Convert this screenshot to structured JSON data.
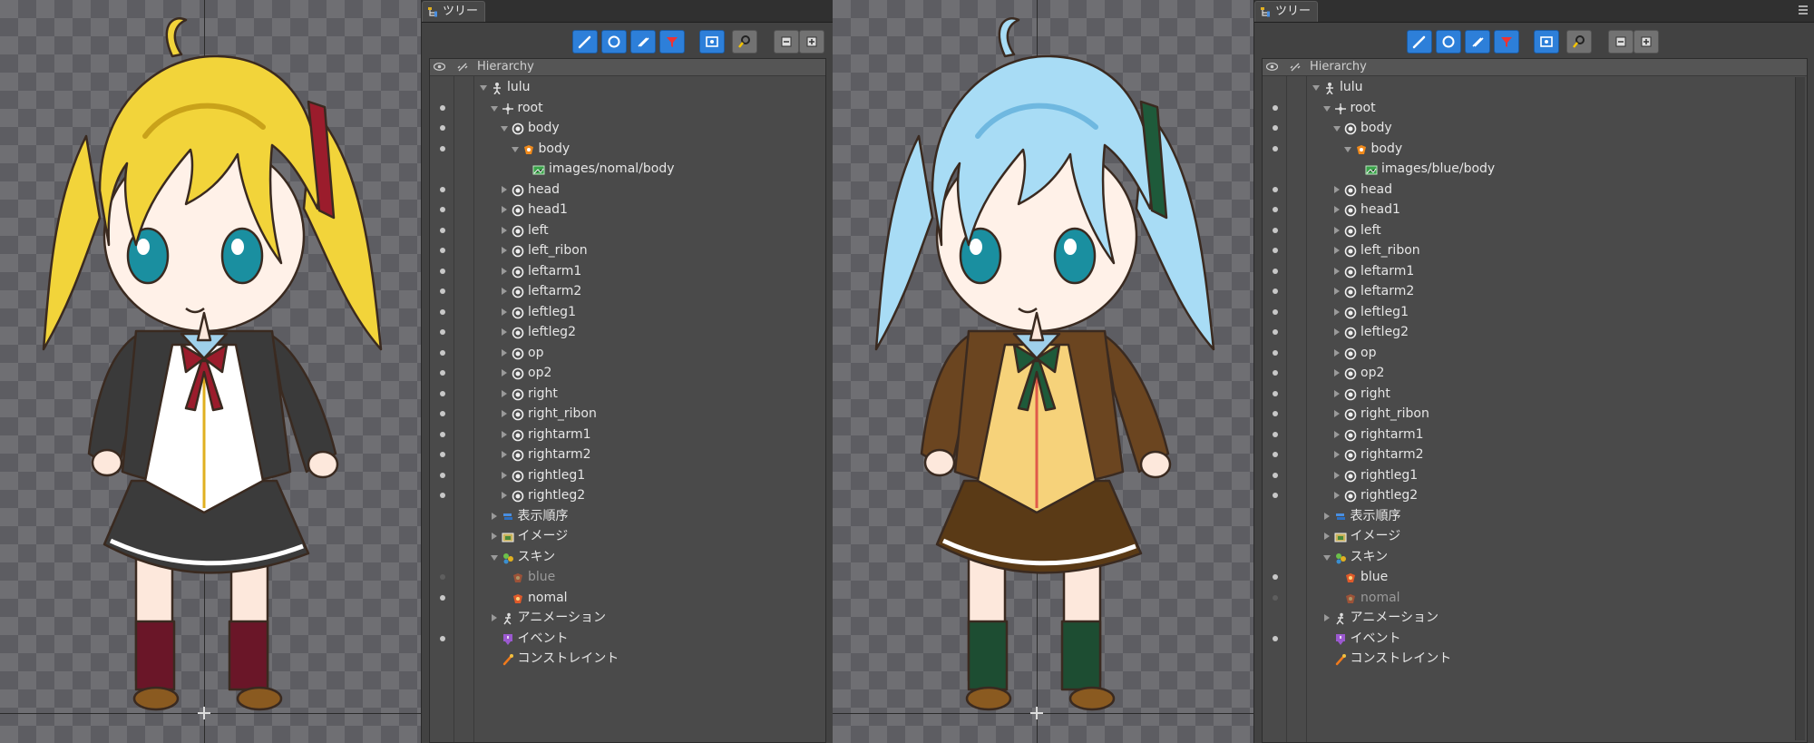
{
  "panels": [
    {
      "tab_label": "ツリー",
      "header_label": "Hierarchy",
      "rows": [
        {
          "label": "lulu",
          "depth": 0,
          "icon": "skeleton-icon",
          "expand": "down",
          "dot": "none"
        },
        {
          "label": "root",
          "depth": 1,
          "icon": "root-bone-icon",
          "expand": "down",
          "dot": "on"
        },
        {
          "label": "body",
          "depth": 2,
          "icon": "slot-icon",
          "expand": "down",
          "dot": "on"
        },
        {
          "label": "body",
          "depth": 3,
          "icon": "skin-attachment-icon",
          "expand": "down",
          "dot": "on"
        },
        {
          "label": "images/nomal/body",
          "depth": 4,
          "icon": "image-icon",
          "expand": "none",
          "dot": "none"
        },
        {
          "label": "head",
          "depth": 2,
          "icon": "slot-icon",
          "expand": "right",
          "dot": "on"
        },
        {
          "label": "head1",
          "depth": 2,
          "icon": "slot-icon",
          "expand": "right",
          "dot": "on"
        },
        {
          "label": "left",
          "depth": 2,
          "icon": "slot-icon",
          "expand": "right",
          "dot": "on"
        },
        {
          "label": "left_ribon",
          "depth": 2,
          "icon": "slot-icon",
          "expand": "right",
          "dot": "on"
        },
        {
          "label": "leftarm1",
          "depth": 2,
          "icon": "slot-icon",
          "expand": "right",
          "dot": "on"
        },
        {
          "label": "leftarm2",
          "depth": 2,
          "icon": "slot-icon",
          "expand": "right",
          "dot": "on"
        },
        {
          "label": "leftleg1",
          "depth": 2,
          "icon": "slot-icon",
          "expand": "right",
          "dot": "on"
        },
        {
          "label": "leftleg2",
          "depth": 2,
          "icon": "slot-icon",
          "expand": "right",
          "dot": "on"
        },
        {
          "label": "op",
          "depth": 2,
          "icon": "slot-icon",
          "expand": "right",
          "dot": "on"
        },
        {
          "label": "op2",
          "depth": 2,
          "icon": "slot-icon",
          "expand": "right",
          "dot": "on"
        },
        {
          "label": "right",
          "depth": 2,
          "icon": "slot-icon",
          "expand": "right",
          "dot": "on"
        },
        {
          "label": "right_ribon",
          "depth": 2,
          "icon": "slot-icon",
          "expand": "right",
          "dot": "on"
        },
        {
          "label": "rightarm1",
          "depth": 2,
          "icon": "slot-icon",
          "expand": "right",
          "dot": "on"
        },
        {
          "label": "rightarm2",
          "depth": 2,
          "icon": "slot-icon",
          "expand": "right",
          "dot": "on"
        },
        {
          "label": "rightleg1",
          "depth": 2,
          "icon": "slot-icon",
          "expand": "right",
          "dot": "on"
        },
        {
          "label": "rightleg2",
          "depth": 2,
          "icon": "slot-icon",
          "expand": "right",
          "dot": "on"
        },
        {
          "label": "表示順序",
          "depth": 1,
          "icon": "draw-order-icon",
          "expand": "right",
          "dot": "none"
        },
        {
          "label": "イメージ",
          "depth": 1,
          "icon": "images-folder-icon",
          "expand": "right",
          "dot": "none"
        },
        {
          "label": "スキン",
          "depth": 1,
          "icon": "skins-icon",
          "expand": "down",
          "dot": "none"
        },
        {
          "label": "blue",
          "depth": 2,
          "icon": "skin-icon",
          "expand": "none",
          "dot": "dim",
          "dim": true
        },
        {
          "label": "nomal",
          "depth": 2,
          "icon": "skin-icon",
          "expand": "none",
          "dot": "on"
        },
        {
          "label": "アニメーション",
          "depth": 1,
          "icon": "animation-icon",
          "expand": "right",
          "dot": "none"
        },
        {
          "label": "イベント",
          "depth": 1,
          "icon": "event-icon",
          "expand": "none",
          "dot": "on"
        },
        {
          "label": "コンストレイント",
          "depth": 1,
          "icon": "constraint-icon",
          "expand": "none",
          "dot": "none"
        }
      ]
    },
    {
      "tab_label": "ツリー",
      "header_label": "Hierarchy",
      "rows": [
        {
          "label": "lulu",
          "depth": 0,
          "icon": "skeleton-icon",
          "expand": "down",
          "dot": "none"
        },
        {
          "label": "root",
          "depth": 1,
          "icon": "root-bone-icon",
          "expand": "down",
          "dot": "on"
        },
        {
          "label": "body",
          "depth": 2,
          "icon": "slot-icon",
          "expand": "down",
          "dot": "on"
        },
        {
          "label": "body",
          "depth": 3,
          "icon": "skin-attachment-icon",
          "expand": "down",
          "dot": "on"
        },
        {
          "label": "images/blue/body",
          "depth": 4,
          "icon": "image-icon",
          "expand": "none",
          "dot": "none"
        },
        {
          "label": "head",
          "depth": 2,
          "icon": "slot-icon",
          "expand": "right",
          "dot": "on"
        },
        {
          "label": "head1",
          "depth": 2,
          "icon": "slot-icon",
          "expand": "right",
          "dot": "on"
        },
        {
          "label": "left",
          "depth": 2,
          "icon": "slot-icon",
          "expand": "right",
          "dot": "on"
        },
        {
          "label": "left_ribon",
          "depth": 2,
          "icon": "slot-icon",
          "expand": "right",
          "dot": "on"
        },
        {
          "label": "leftarm1",
          "depth": 2,
          "icon": "slot-icon",
          "expand": "right",
          "dot": "on"
        },
        {
          "label": "leftarm2",
          "depth": 2,
          "icon": "slot-icon",
          "expand": "right",
          "dot": "on"
        },
        {
          "label": "leftleg1",
          "depth": 2,
          "icon": "slot-icon",
          "expand": "right",
          "dot": "on"
        },
        {
          "label": "leftleg2",
          "depth": 2,
          "icon": "slot-icon",
          "expand": "right",
          "dot": "on"
        },
        {
          "label": "op",
          "depth": 2,
          "icon": "slot-icon",
          "expand": "right",
          "dot": "on"
        },
        {
          "label": "op2",
          "depth": 2,
          "icon": "slot-icon",
          "expand": "right",
          "dot": "on"
        },
        {
          "label": "right",
          "depth": 2,
          "icon": "slot-icon",
          "expand": "right",
          "dot": "on"
        },
        {
          "label": "right_ribon",
          "depth": 2,
          "icon": "slot-icon",
          "expand": "right",
          "dot": "on"
        },
        {
          "label": "rightarm1",
          "depth": 2,
          "icon": "slot-icon",
          "expand": "right",
          "dot": "on"
        },
        {
          "label": "rightarm2",
          "depth": 2,
          "icon": "slot-icon",
          "expand": "right",
          "dot": "on"
        },
        {
          "label": "rightleg1",
          "depth": 2,
          "icon": "slot-icon",
          "expand": "right",
          "dot": "on"
        },
        {
          "label": "rightleg2",
          "depth": 2,
          "icon": "slot-icon",
          "expand": "right",
          "dot": "on"
        },
        {
          "label": "表示順序",
          "depth": 1,
          "icon": "draw-order-icon",
          "expand": "right",
          "dot": "none"
        },
        {
          "label": "イメージ",
          "depth": 1,
          "icon": "images-folder-icon",
          "expand": "right",
          "dot": "none"
        },
        {
          "label": "スキン",
          "depth": 1,
          "icon": "skins-icon",
          "expand": "down",
          "dot": "none"
        },
        {
          "label": "blue",
          "depth": 2,
          "icon": "skin-icon",
          "expand": "none",
          "dot": "on"
        },
        {
          "label": "nomal",
          "depth": 2,
          "icon": "skin-icon",
          "expand": "none",
          "dot": "dim",
          "dim": true
        },
        {
          "label": "アニメーション",
          "depth": 1,
          "icon": "animation-icon",
          "expand": "right",
          "dot": "none"
        },
        {
          "label": "イベント",
          "depth": 1,
          "icon": "event-icon",
          "expand": "none",
          "dot": "on"
        },
        {
          "label": "コンストレイント",
          "depth": 1,
          "icon": "constraint-icon",
          "expand": "none",
          "dot": "none"
        }
      ]
    }
  ],
  "toolbar_buttons": [
    "bone-tool-icon",
    "slot-tool-icon",
    "attachment-tool-icon",
    "filter-icon",
    "frame-view-icon",
    "search-icon",
    "collapse-icon",
    "expand-icon"
  ],
  "characters": [
    {
      "skin": "nomal",
      "hair": "#f2d43a",
      "hair_shadow": "#c9a21a",
      "jacket": "#3a3a3a",
      "vest": "#ffffff",
      "ribbon": "#9b1c2c",
      "skirt": "#3b3b3b",
      "socks": "#6a1628",
      "eyes": "#1a8fa0"
    },
    {
      "skin": "blue",
      "hair": "#a8dcf5",
      "hair_shadow": "#6fb8e0",
      "jacket": "#6b4520",
      "vest": "#f6d27a",
      "ribbon": "#1e5a3a",
      "skirt": "#5a3a16",
      "socks": "#1d4d32",
      "eyes": "#1a8fa0"
    }
  ]
}
